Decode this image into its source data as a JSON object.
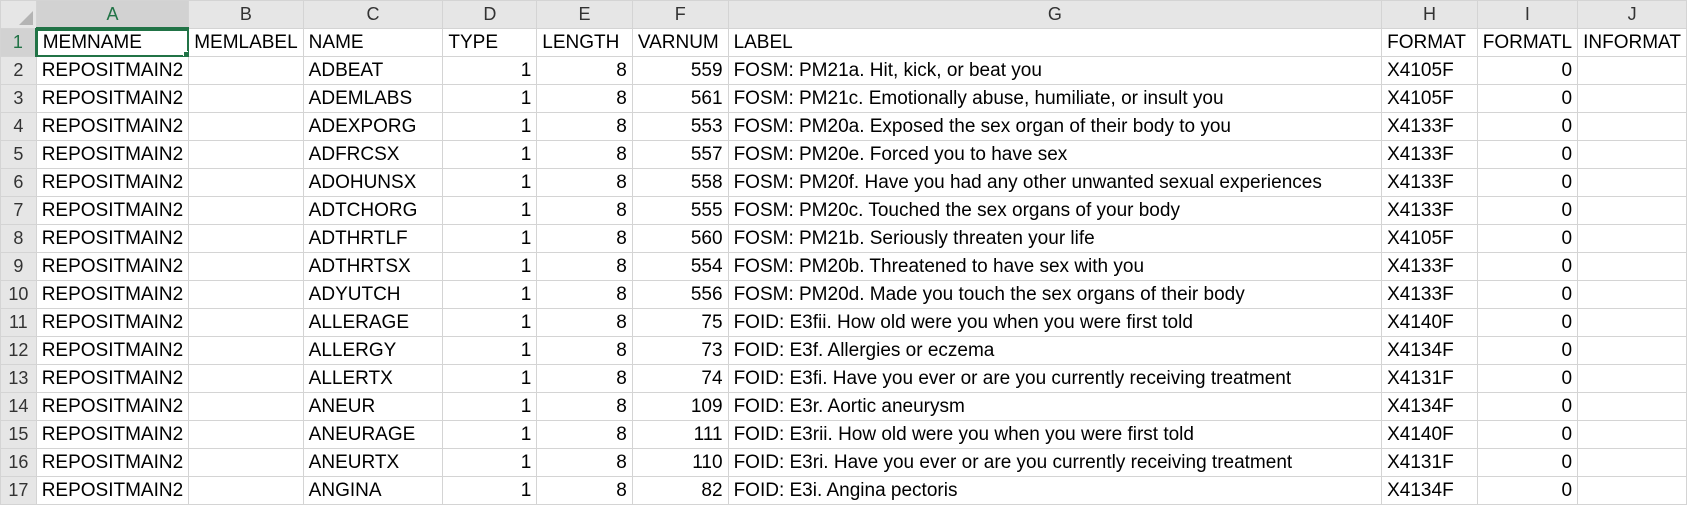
{
  "columns": [
    "A",
    "B",
    "C",
    "D",
    "E",
    "F",
    "G",
    "H",
    "I",
    "J"
  ],
  "rows": [
    {
      "n": "1",
      "c": [
        "MEMNAME",
        "MEMLABEL",
        "NAME",
        "TYPE",
        "LENGTH",
        "VARNUM",
        "LABEL",
        "FORMAT",
        "FORMATL",
        "INFORMAT"
      ]
    },
    {
      "n": "2",
      "c": [
        "REPOSITMAIN2",
        "",
        "ADBEAT",
        "1",
        "8",
        "559",
        "FOSM: PM21a. Hit, kick, or beat you",
        "X4105F",
        "0",
        ""
      ]
    },
    {
      "n": "3",
      "c": [
        "REPOSITMAIN2",
        "",
        "ADEMLABS",
        "1",
        "8",
        "561",
        "FOSM: PM21c. Emotionally abuse, humiliate, or insult you",
        "X4105F",
        "0",
        ""
      ]
    },
    {
      "n": "4",
      "c": [
        "REPOSITMAIN2",
        "",
        "ADEXPORG",
        "1",
        "8",
        "553",
        "FOSM: PM20a. Exposed the sex organ of their body to you",
        "X4133F",
        "0",
        ""
      ]
    },
    {
      "n": "5",
      "c": [
        "REPOSITMAIN2",
        "",
        "ADFRCSX",
        "1",
        "8",
        "557",
        "FOSM: PM20e. Forced you to have sex",
        "X4133F",
        "0",
        ""
      ]
    },
    {
      "n": "6",
      "c": [
        "REPOSITMAIN2",
        "",
        "ADOHUNSX",
        "1",
        "8",
        "558",
        "FOSM: PM20f. Have you had any other unwanted sexual experiences",
        "X4133F",
        "0",
        ""
      ]
    },
    {
      "n": "7",
      "c": [
        "REPOSITMAIN2",
        "",
        "ADTCHORG",
        "1",
        "8",
        "555",
        "FOSM: PM20c. Touched the sex organs of your body",
        "X4133F",
        "0",
        ""
      ]
    },
    {
      "n": "8",
      "c": [
        "REPOSITMAIN2",
        "",
        "ADTHRTLF",
        "1",
        "8",
        "560",
        "FOSM: PM21b. Seriously threaten your life",
        "X4105F",
        "0",
        ""
      ]
    },
    {
      "n": "9",
      "c": [
        "REPOSITMAIN2",
        "",
        "ADTHRTSX",
        "1",
        "8",
        "554",
        "FOSM: PM20b. Threatened to have sex with you",
        "X4133F",
        "0",
        ""
      ]
    },
    {
      "n": "10",
      "c": [
        "REPOSITMAIN2",
        "",
        "ADYUTCH",
        "1",
        "8",
        "556",
        "FOSM: PM20d. Made you touch the sex organs of their body",
        "X4133F",
        "0",
        ""
      ]
    },
    {
      "n": "11",
      "c": [
        "REPOSITMAIN2",
        "",
        "ALLERAGE",
        "1",
        "8",
        "75",
        "FOID: E3fii. How old were you when you were first told",
        "X4140F",
        "0",
        ""
      ]
    },
    {
      "n": "12",
      "c": [
        "REPOSITMAIN2",
        "",
        "ALLERGY",
        "1",
        "8",
        "73",
        "FOID: E3f. Allergies or eczema",
        "X4134F",
        "0",
        ""
      ]
    },
    {
      "n": "13",
      "c": [
        "REPOSITMAIN2",
        "",
        "ALLERTX",
        "1",
        "8",
        "74",
        "FOID: E3fi. Have you ever or are you currently receiving treatment",
        "X4131F",
        "0",
        ""
      ]
    },
    {
      "n": "14",
      "c": [
        "REPOSITMAIN2",
        "",
        "ANEUR",
        "1",
        "8",
        "109",
        "FOID: E3r. Aortic aneurysm",
        "X4134F",
        "0",
        ""
      ]
    },
    {
      "n": "15",
      "c": [
        "REPOSITMAIN2",
        "",
        "ANEURAGE",
        "1",
        "8",
        "111",
        "FOID: E3rii. How old were you when you were first told",
        "X4140F",
        "0",
        ""
      ]
    },
    {
      "n": "16",
      "c": [
        "REPOSITMAIN2",
        "",
        "ANEURTX",
        "1",
        "8",
        "110",
        "FOID: E3ri. Have you ever or are you currently receiving treatment",
        "X4131F",
        "0",
        ""
      ]
    },
    {
      "n": "17",
      "c": [
        "REPOSITMAIN2",
        "",
        "ANGINA",
        "1",
        "8",
        "82",
        "FOID: E3i. Angina pectoris",
        "X4134F",
        "0",
        ""
      ]
    }
  ],
  "numeric_columns": [
    3,
    4,
    5,
    8
  ],
  "selected_column": "A",
  "selected_row": "1",
  "accent_color": "#217346"
}
